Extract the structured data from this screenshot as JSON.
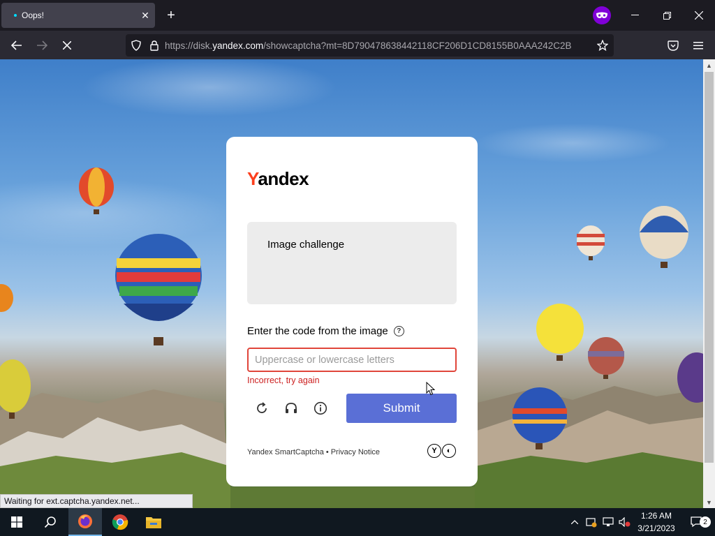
{
  "browser": {
    "tab_title": "Oops!",
    "url_prefix": "https://disk.",
    "url_host": "yandex.com",
    "url_rest": "/showcaptcha?mt=8D790478638442118CF206D1CD8155B0AAA242C2B",
    "status_text": "Waiting for ext.captcha.yandex.net..."
  },
  "captcha": {
    "logo_y": "Y",
    "logo_rest": "andex",
    "challenge_text": "Image challenge",
    "code_label": "Enter the code from the image",
    "help_glyph": "?",
    "input_value": "",
    "input_placeholder": "Uppercase or lowercase letters",
    "error_text": "Incorrect, try again",
    "submit_label": "Submit",
    "footer_brand": "Yandex SmartCaptcha",
    "footer_separator": "•",
    "footer_privacy": "Privacy Notice"
  },
  "taskbar": {
    "time": "1:26 AM",
    "date": "3/21/2023",
    "notification_count": "2"
  },
  "colors": {
    "brand_red": "#fc3f1d",
    "submit_blue": "#5a6fd6",
    "error_red": "#cc1f1f"
  }
}
